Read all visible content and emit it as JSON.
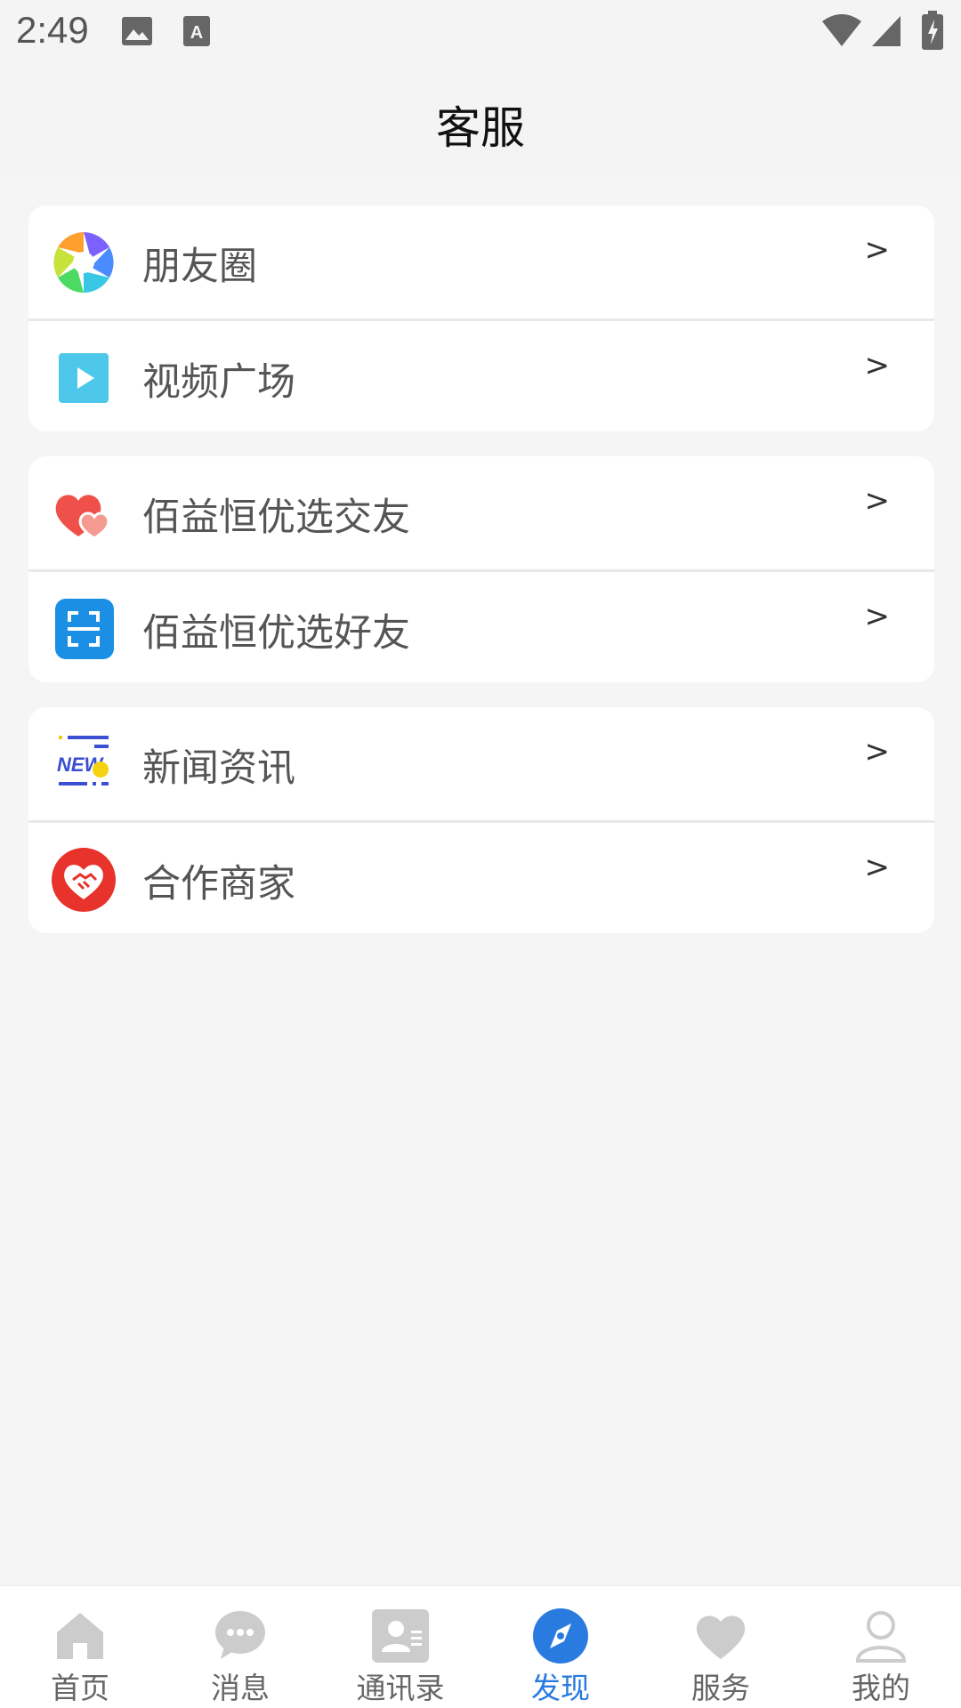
{
  "status_bar": {
    "time": "2:49",
    "icons": [
      "image-icon",
      "text-a-icon",
      "wifi-icon",
      "signal-icon",
      "battery-charging-icon"
    ]
  },
  "header": {
    "title": "客服"
  },
  "groups": [
    {
      "items": [
        {
          "label": "朋友圈",
          "arrow": ">",
          "icon": "aperture-icon"
        },
        {
          "label": "视频广场",
          "arrow": ">",
          "icon": "play-icon"
        }
      ]
    },
    {
      "items": [
        {
          "label": "佰益恒优选交友",
          "arrow": ">",
          "icon": "hearts-icon"
        },
        {
          "label": "佰益恒优选好友",
          "arrow": ">",
          "icon": "scan-icon"
        }
      ]
    },
    {
      "items": [
        {
          "label": "新闻资讯",
          "arrow": ">",
          "icon": "news-icon"
        },
        {
          "label": "合作商家",
          "arrow": ">",
          "icon": "handshake-heart-icon"
        }
      ]
    }
  ],
  "bottom_nav": {
    "items": [
      {
        "label": "首页",
        "icon": "home-icon",
        "active": false
      },
      {
        "label": "消息",
        "icon": "chat-icon",
        "active": false
      },
      {
        "label": "通讯录",
        "icon": "contacts-icon",
        "active": false
      },
      {
        "label": "发现",
        "icon": "compass-icon",
        "active": true
      },
      {
        "label": "服务",
        "icon": "heart-icon",
        "active": false
      },
      {
        "label": "我的",
        "icon": "user-icon",
        "active": false
      }
    ],
    "active_color": "#2a7be0",
    "inactive_color": "#cccccc"
  }
}
